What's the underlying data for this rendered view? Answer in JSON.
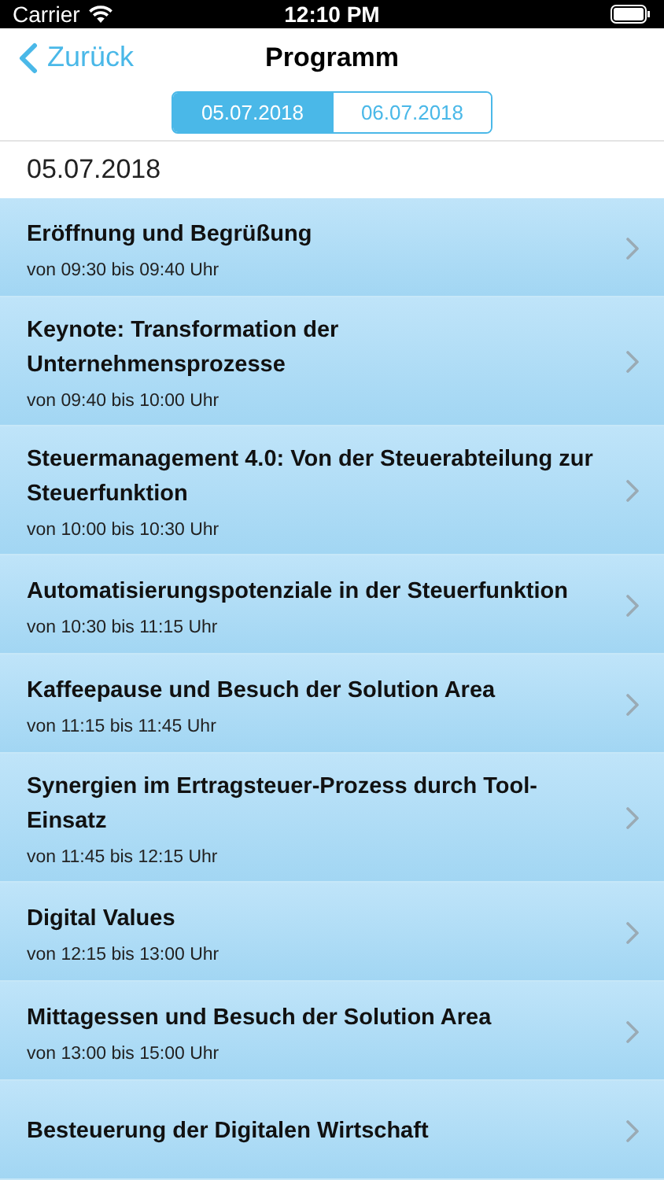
{
  "status_bar": {
    "carrier": "Carrier",
    "time": "12:10 PM"
  },
  "nav": {
    "back": "Zurück",
    "title": "Programm"
  },
  "tabs": [
    {
      "label": "05.07.2018",
      "selected": true
    },
    {
      "label": "06.07.2018",
      "selected": false
    }
  ],
  "section_header": "05.07.2018",
  "sessions": [
    {
      "title": "Eröffnung und Begrüßung",
      "time": "von 09:30 bis 09:40 Uhr"
    },
    {
      "title": "Keynote: Transformation der Unternehmensprozesse",
      "time": "von 09:40 bis 10:00 Uhr"
    },
    {
      "title": "Steuermanagement 4.0: Von der Steuerabteilung zur Steuerfunktion",
      "time": "von 10:00 bis 10:30 Uhr"
    },
    {
      "title": "Automatisierungspotenziale in der Steuerfunktion",
      "time": "von 10:30 bis 11:15 Uhr"
    },
    {
      "title": "Kaffeepause und Besuch der Solution Area",
      "time": "von 11:15 bis 11:45 Uhr"
    },
    {
      "title": "Synergien im Ertragsteuer-Prozess durch Tool-Einsatz",
      "time": "von 11:45 bis 12:15 Uhr"
    },
    {
      "title": "Digital Values",
      "time": "von 12:15 bis 13:00 Uhr"
    },
    {
      "title": "Mittagessen und Besuch der Solution Area",
      "time": "von 13:00 bis 15:00 Uhr"
    },
    {
      "title": "Besteuerung der Digitalen Wirtschaft"
    }
  ]
}
